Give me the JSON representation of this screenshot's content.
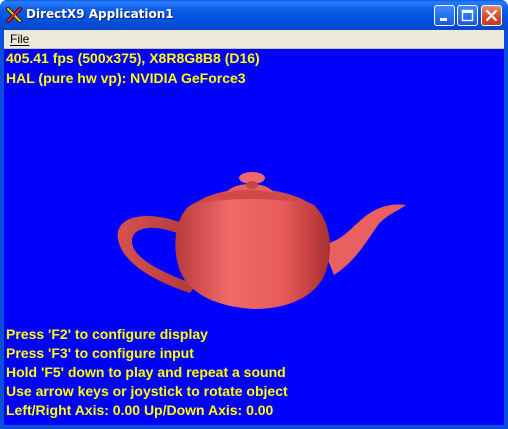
{
  "window": {
    "title": "DirectX9 Application1",
    "icon": "directx-x-icon",
    "controls": {
      "minimize_icon": "minimize-icon",
      "maximize_icon": "maximize-icon",
      "close_icon": "close-icon"
    }
  },
  "menubar": {
    "items": [
      {
        "label": "File"
      }
    ]
  },
  "viewport": {
    "background": "#0000ff",
    "text_color": "#ffff00",
    "object_color": "#e85a5a",
    "stats": [
      "405.41 fps (500x375), X8R8G8B8 (D16)",
      "HAL (pure hw vp): NVIDIA GeForce3"
    ],
    "help": [
      "Press 'F2' to configure display",
      "Press 'F3' to configure input",
      "Hold 'F5' down to play and repeat a sound",
      "Use arrow keys or joystick to rotate object",
      "Left/Right Axis: 0.00 Up/Down Axis: 0.00"
    ]
  }
}
